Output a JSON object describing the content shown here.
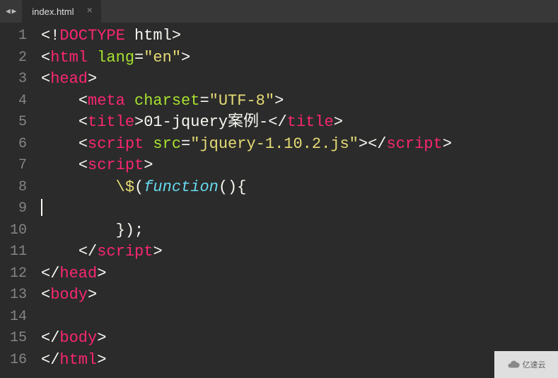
{
  "tab": {
    "label": "index.html"
  },
  "gutter": [
    "1",
    "2",
    "3",
    "4",
    "5",
    "6",
    "7",
    "8",
    "9",
    "10",
    "11",
    "12",
    "13",
    "14",
    "15",
    "16"
  ],
  "code": {
    "l1": {
      "open": "<",
      "bang": "!",
      "doctype": "DOCTYPE",
      "html": " html",
      "close": ">"
    },
    "l2": {
      "open": "<",
      "tag": "html",
      "attr": " lang",
      "eq": "=",
      "val": "\"en\"",
      "close": ">"
    },
    "l3": {
      "open": "<",
      "tag": "head",
      "close": ">"
    },
    "l4": {
      "indent": "    ",
      "open": "<",
      "tag": "meta",
      "attr": " charset",
      "eq": "=",
      "val": "\"UTF-8\"",
      "close": ">"
    },
    "l5": {
      "indent": "    ",
      "open": "<",
      "tag": "title",
      "close": ">",
      "text": "01-jquery案例-",
      "open2": "</",
      "tag2": "title",
      "close2": ">"
    },
    "l6": {
      "indent": "    ",
      "open": "<",
      "tag": "script",
      "attr": " src",
      "eq": "=",
      "val": "\"jquery-1.10.2.js\"",
      "close": ">",
      "open2": "</",
      "tag2": "script",
      "close2": ">"
    },
    "l7": {
      "indent": "    ",
      "open": "<",
      "tag": "script",
      "close": ">"
    },
    "l8": {
      "indent": "        ",
      "esc": "\\$",
      "p1": "(",
      "fn": "function",
      "p2": "(){"
    },
    "l9": {
      "indent": ""
    },
    "l10": {
      "indent": "        ",
      "p": "});"
    },
    "l11": {
      "indent": "    ",
      "open": "</",
      "tag": "script",
      "close": ">"
    },
    "l12": {
      "open": "</",
      "tag": "head",
      "close": ">"
    },
    "l13": {
      "open": "<",
      "tag": "body",
      "close": ">"
    },
    "l14": {
      "indent": ""
    },
    "l15": {
      "open": "</",
      "tag": "body",
      "close": ">"
    },
    "l16": {
      "open": "</",
      "tag": "html",
      "close": ">"
    }
  },
  "watermark": "亿速云"
}
